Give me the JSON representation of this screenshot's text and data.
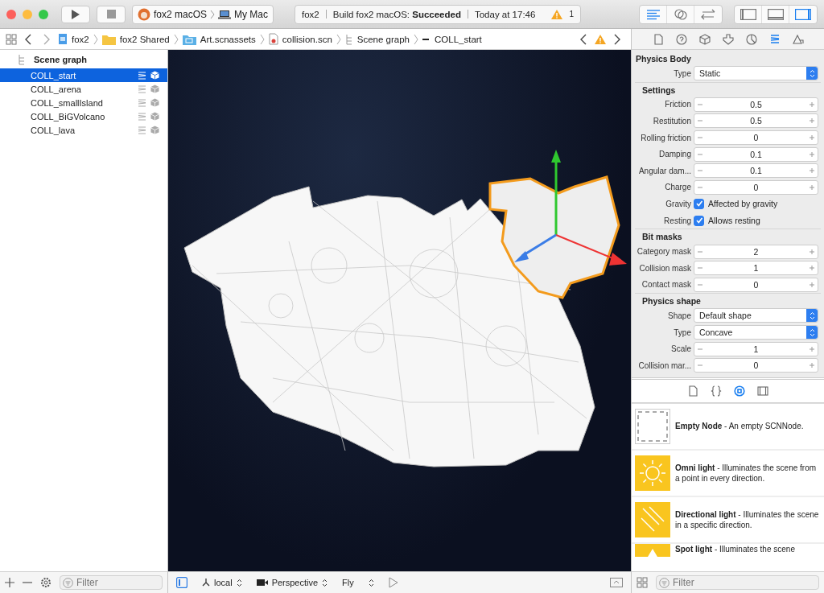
{
  "toolbar": {
    "scheme": {
      "target": "fox2 macOS",
      "device": "My Mac"
    },
    "activity": {
      "project": "fox2",
      "status_prefix": "Build fox2 macOS: ",
      "status": "Succeeded",
      "time": "Today at 17:46",
      "warnings": "1"
    },
    "editor_modes": [
      {
        "kind": "standard",
        "selected": true
      },
      {
        "kind": "assistant",
        "selected": false
      },
      {
        "kind": "version",
        "selected": false
      }
    ],
    "panels": [
      {
        "kind": "left",
        "selected": false
      },
      {
        "kind": "bottom",
        "selected": false
      },
      {
        "kind": "right",
        "selected": true
      }
    ]
  },
  "breadcrumbs": [
    {
      "kind": "project",
      "label": "fox2"
    },
    {
      "kind": "folder",
      "label": "fox2 Shared"
    },
    {
      "kind": "assets",
      "label": "Art.scnassets"
    },
    {
      "kind": "scene",
      "label": "collision.scn"
    },
    {
      "kind": "graph",
      "label": "Scene graph"
    },
    {
      "kind": "node",
      "label": "COLL_start"
    }
  ],
  "scene_graph": {
    "title": "Scene graph",
    "nodes": [
      {
        "name": "COLL_start",
        "selected": true
      },
      {
        "name": "COLL_arena",
        "selected": false
      },
      {
        "name": "COLL_smallIsland",
        "selected": false
      },
      {
        "name": "COLL_BiGVolcano",
        "selected": false
      },
      {
        "name": "COLL_lava",
        "selected": false
      }
    ],
    "filter_placeholder": "Filter"
  },
  "viewport_bar": {
    "space": "local",
    "camera": "Perspective",
    "mode": "Fly"
  },
  "inspector_tabs": [
    {
      "kind": "file",
      "selected": false
    },
    {
      "kind": "help",
      "selected": false
    },
    {
      "kind": "node",
      "selected": false
    },
    {
      "kind": "attributes",
      "selected": false
    },
    {
      "kind": "material",
      "selected": false
    },
    {
      "kind": "physics",
      "selected": true
    },
    {
      "kind": "shape",
      "selected": false
    }
  ],
  "physics": [
    {
      "title": "Physics Body",
      "rows": [
        {
          "kind": "select",
          "label": "Type",
          "value": "Static"
        }
      ]
    },
    {
      "title": "Settings",
      "rows": [
        {
          "kind": "stepper",
          "label": "Friction",
          "value": "0.5"
        },
        {
          "kind": "stepper",
          "label": "Restitution",
          "value": "0.5"
        },
        {
          "kind": "stepper",
          "label": "Rolling friction",
          "value": "0"
        },
        {
          "kind": "stepper",
          "label": "Damping",
          "value": "0.1"
        },
        {
          "kind": "stepper",
          "label": "Angular dam...",
          "value": "0.1"
        },
        {
          "kind": "stepper",
          "label": "Charge",
          "value": "0"
        },
        {
          "kind": "checkbox",
          "label": "Gravity",
          "value": "Affected by gravity",
          "checked": true
        },
        {
          "kind": "checkbox",
          "label": "Resting",
          "value": "Allows resting",
          "checked": true
        }
      ]
    },
    {
      "title": "Bit masks",
      "rows": [
        {
          "kind": "stepper",
          "label": "Category mask",
          "value": "2"
        },
        {
          "kind": "stepper",
          "label": "Collision mask",
          "value": "1"
        },
        {
          "kind": "stepper",
          "label": "Contact mask",
          "value": "0"
        }
      ]
    },
    {
      "title": "Physics shape",
      "rows": [
        {
          "kind": "select",
          "label": "Shape",
          "value": "Default shape"
        },
        {
          "kind": "select",
          "label": "Type",
          "value": "Concave"
        },
        {
          "kind": "stepper",
          "label": "Scale",
          "value": "1"
        },
        {
          "kind": "stepper",
          "label": "Collision mar...",
          "value": "0"
        }
      ]
    }
  ],
  "library_tabs": [
    {
      "kind": "file",
      "selected": false
    },
    {
      "kind": "code",
      "selected": false
    },
    {
      "kind": "object",
      "selected": true
    },
    {
      "kind": "media",
      "selected": false
    }
  ],
  "library": [
    {
      "kind": "empty",
      "text": "**Empty Node** - An empty SCNNode."
    },
    {
      "kind": "omni",
      "text": "**Omni light** - Illuminates the scene from a point in every direction."
    },
    {
      "kind": "directional",
      "text": "**Directional light** - Illuminates the scene in a specific direction."
    },
    {
      "kind": "spot",
      "text": "**Spot light** - Illuminates the scene"
    }
  ],
  "library_filter_placeholder": "Filter"
}
